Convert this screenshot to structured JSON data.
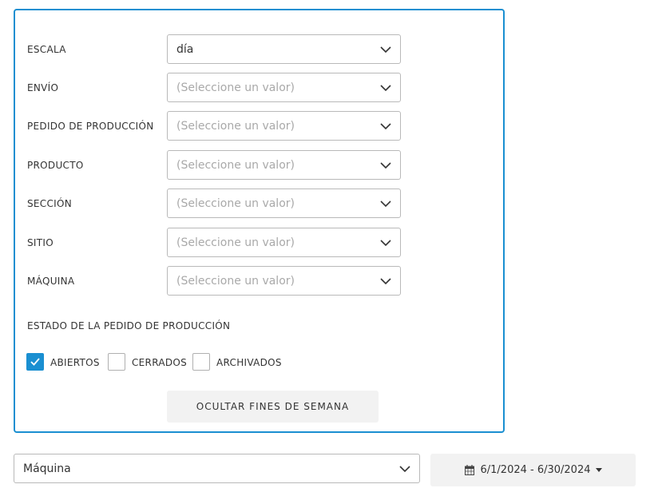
{
  "filters": {
    "rows": [
      {
        "label": "ESCALA",
        "value": "día",
        "placeholder": false
      },
      {
        "label": "ENVÍO",
        "value": "(Seleccione un valor)",
        "placeholder": true
      },
      {
        "label": "PEDIDO DE PRODUCCIÓN",
        "value": "(Seleccione un valor)",
        "placeholder": true
      },
      {
        "label": "PRODUCTO",
        "value": "(Seleccione un valor)",
        "placeholder": true
      },
      {
        "label": "SECCIÓN",
        "value": "(Seleccione un valor)",
        "placeholder": true
      },
      {
        "label": "SITIO",
        "value": "(Seleccione un valor)",
        "placeholder": true
      },
      {
        "label": "MÁQUINA",
        "value": "(Seleccione un valor)",
        "placeholder": true
      }
    ],
    "status_label": "ESTADO DE LA PEDIDO DE PRODUCCIÓN",
    "status_options": [
      {
        "label": "ABIERTOS",
        "checked": true
      },
      {
        "label": "CERRADOS",
        "checked": false
      },
      {
        "label": "ARCHIVADOS",
        "checked": false
      }
    ],
    "hide_weekends_label": "OCULTAR FINES DE SEMANA"
  },
  "toolbar": {
    "group_by_value": "Máquina",
    "date_range": "6/1/2024 - 6/30/2024"
  },
  "colors": {
    "accent": "#1a8fd1",
    "button_bg": "#f2f2f2",
    "border": "#b9b9b9"
  },
  "icons": {
    "dropdown": "chevron-down-icon",
    "checkbox": "check-icon",
    "date": "calendar-icon",
    "caret": "caret-down-icon"
  }
}
